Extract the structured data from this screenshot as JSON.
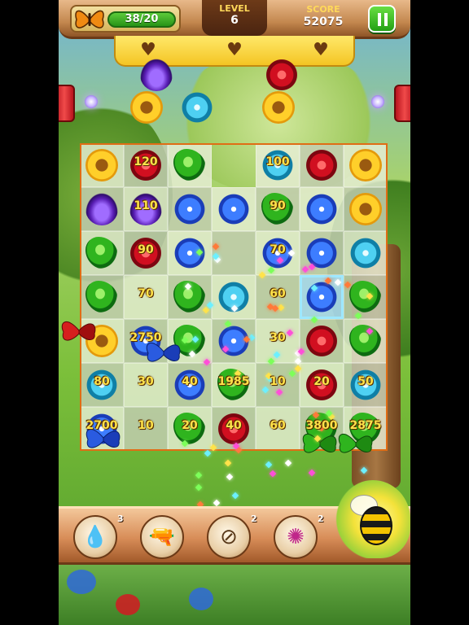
{
  "hud": {
    "lives_value": "38/20",
    "lives_icon": "butterfly-icon",
    "level_label": "LEVEL",
    "level_value": "6",
    "score_label": "SCORE",
    "score_value": "52075",
    "pause_icon": "pause-icon",
    "hearts": [
      "heart-icon",
      "heart-icon",
      "heart-icon"
    ]
  },
  "board": {
    "cols": 7,
    "rows": 7,
    "selected_cell": "4,3",
    "cells": [
      [
        {
          "f": "sunflower"
        },
        {
          "f": "rose",
          "p": "120"
        },
        {
          "f": "leaf"
        },
        null,
        {
          "f": "lily",
          "p": "100"
        },
        {
          "f": "rose"
        },
        {
          "f": "sunflower"
        }
      ],
      [
        {
          "f": "tulip"
        },
        {
          "f": "tulip",
          "p": "110"
        },
        {
          "f": "forget"
        },
        {
          "f": "forget"
        },
        {
          "f": "leaf",
          "p": "90"
        },
        {
          "f": "forget"
        },
        {
          "f": "sunflower"
        }
      ],
      [
        {
          "f": "leaf"
        },
        {
          "f": "rose",
          "p": "90"
        },
        {
          "f": "forget"
        },
        {
          "f": ""
        },
        {
          "f": "forget",
          "p": "70"
        },
        {
          "f": "forget"
        },
        {
          "f": "lily"
        }
      ],
      [
        {
          "f": "leaf"
        },
        {
          "f": "",
          "p": "70"
        },
        {
          "f": "leaf"
        },
        {
          "f": "lily"
        },
        {
          "f": "",
          "p": "60"
        },
        {
          "f": "forget"
        },
        {
          "f": "leaf"
        }
      ],
      [
        {
          "f": "sunflower"
        },
        {
          "f": "forget",
          "p": "2750"
        },
        {
          "f": "leaf"
        },
        {
          "f": "forget"
        },
        {
          "f": "",
          "p": "30"
        },
        {
          "f": "rose"
        },
        {
          "f": "leaf"
        }
      ],
      [
        {
          "f": "lily",
          "p": "80"
        },
        {
          "f": "",
          "p": "30"
        },
        {
          "f": "forget",
          "p": "40"
        },
        {
          "f": "leaf",
          "p": "1985"
        },
        {
          "f": "",
          "p": "10"
        },
        {
          "f": "rose",
          "p": "20"
        },
        {
          "f": "lily",
          "p": "50"
        }
      ],
      [
        {
          "f": "forget",
          "p": "2700"
        },
        {
          "f": "",
          "p": "10"
        },
        {
          "f": "leaf",
          "p": "20"
        },
        {
          "f": "rose",
          "p": "40"
        },
        {
          "f": "",
          "p": "60"
        },
        {
          "f": "leaf",
          "p": "3800"
        },
        {
          "f": "leaf",
          "p": "2875"
        }
      ]
    ]
  },
  "falling_flowers": [
    "tulip",
    "rose",
    "sunflower",
    "lily",
    "sunflower"
  ],
  "toolbar": {
    "tools": [
      {
        "name": "water-balloon-tool",
        "icon": "water-drop-icon",
        "count": "3"
      },
      {
        "name": "water-gun-tool",
        "icon": "water-gun-icon",
        "count": ""
      },
      {
        "name": "net-tool",
        "icon": "butterfly-net-icon",
        "count": "2"
      },
      {
        "name": "pinwheel-tool",
        "icon": "pinwheel-icon",
        "count": "2"
      }
    ],
    "booster": "bee-booster-icon"
  },
  "colors": {
    "accent_green": "#23a015",
    "wood": "#c4884f",
    "gold_text": "#ffe34a",
    "board_border": "#e06d15"
  }
}
